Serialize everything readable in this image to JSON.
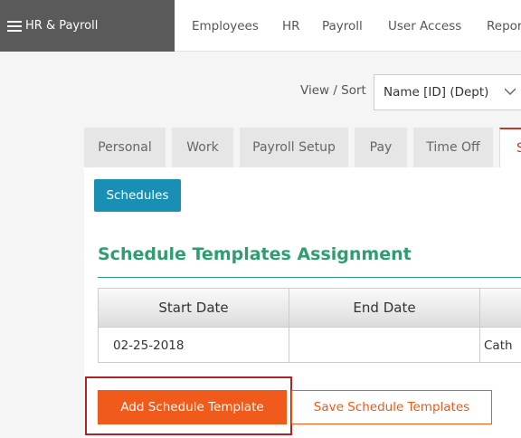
{
  "nav": {
    "brand": "HR & Payroll",
    "items": [
      "Employees",
      "HR",
      "Payroll",
      "User Access",
      "Repor"
    ]
  },
  "view_sort": {
    "label": "View / Sort",
    "value": "Name [ID] (Dept)"
  },
  "tabs": [
    "Personal",
    "Work",
    "Payroll Setup",
    "Pay",
    "Time Off",
    "S"
  ],
  "active_tab_index": 5,
  "panel": {
    "schedules_button": "Schedules",
    "section_title": "Schedule Templates Assignment",
    "table": {
      "columns": [
        "Start Date",
        "End Date",
        ""
      ],
      "rows": [
        [
          "02-25-2018",
          "",
          "Cath"
        ]
      ]
    },
    "add_button": "Add Schedule Template",
    "save_button": "Save Schedule Templates"
  },
  "colors": {
    "brand_bg": "#5a5a5a",
    "accent_blue": "#1a8fb4",
    "section_green": "#2e9e6f",
    "action_orange": "#f05a1a",
    "highlight_red": "#b22222"
  }
}
